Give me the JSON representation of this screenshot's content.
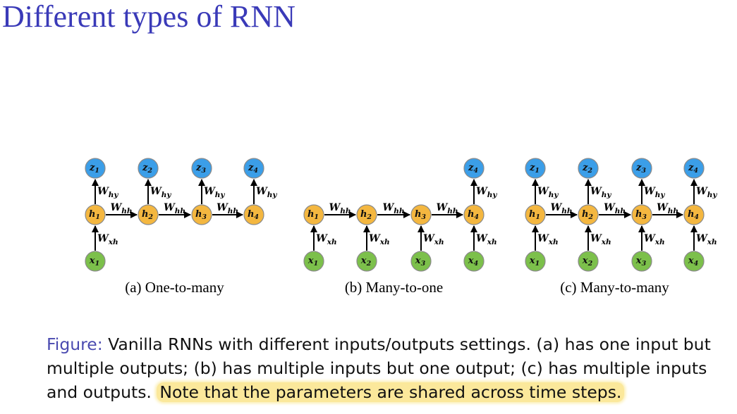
{
  "slide": {
    "title": "Different types of RNN"
  },
  "colors": {
    "title": "#3a3ab8",
    "output_node": "#3b9ee8",
    "hidden_node": "#f4b740",
    "input_node": "#7cc04b",
    "node_stroke": "#8a8a8a",
    "highlight": "#fbe89b"
  },
  "weights": {
    "hy": "hy",
    "hh": "hh",
    "xh": "xh"
  },
  "panels": [
    {
      "id": "a",
      "label": "(a) One-to-many",
      "outputs": [
        "1",
        "2",
        "3",
        "4"
      ],
      "hidden": [
        "1",
        "2",
        "3",
        "4"
      ],
      "inputs": [
        "1"
      ]
    },
    {
      "id": "b",
      "label": "(b) Many-to-one",
      "outputs": [
        "4"
      ],
      "hidden": [
        "1",
        "2",
        "3",
        "4"
      ],
      "inputs": [
        "1",
        "2",
        "3",
        "4"
      ]
    },
    {
      "id": "c",
      "label": "(c) Many-to-many",
      "outputs": [
        "1",
        "2",
        "3",
        "4"
      ],
      "hidden": [
        "1",
        "2",
        "3",
        "4"
      ],
      "inputs": [
        "1",
        "2",
        "3",
        "4"
      ]
    }
  ],
  "caption": {
    "prefix": "Figure:",
    "body": " Vanilla RNNs with different inputs/outputs settings. (a) has one input but multiple outputs; (b) has multiple inputs but one output; (c) has multiple inputs and outputs. ",
    "highlight": "Note that the parameters are shared across time steps."
  }
}
